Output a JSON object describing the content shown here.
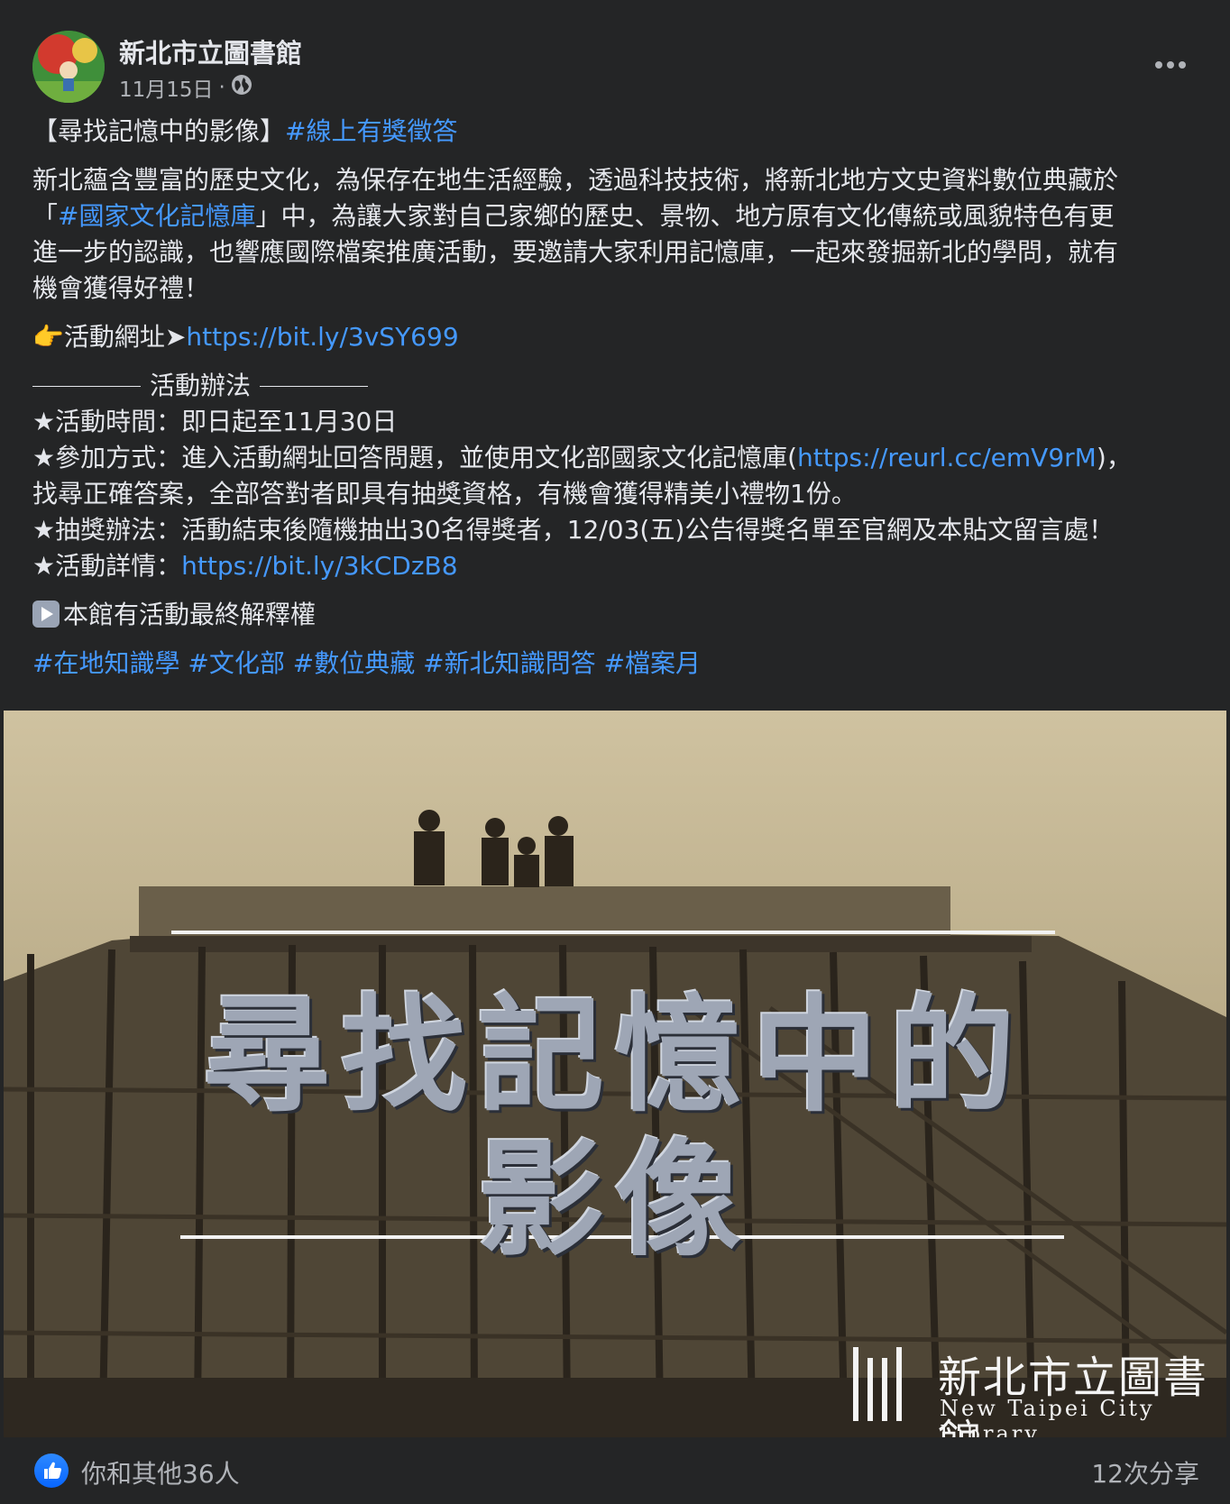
{
  "header": {
    "page_name": "新北市立圖書館",
    "date": "11月15日",
    "separator": "·",
    "privacy_icon": "globe-icon",
    "more_icon": "more-dots-icon"
  },
  "post": {
    "title_prefix": "【尋找記憶中的影像】",
    "title_hashtag": "#線上有獎徵答",
    "intro_1": "新北蘊含豐富的歷史文化，為保存在地生活經驗，透過科技技術，將新北地方文史資料數位典藏於",
    "intro_2_open": "「",
    "intro_2_link": "#國家文化記憶庫",
    "intro_2_rest": "」中，為讓大家對自己家鄉的歷史、景物、地方原有文化傳統或風貌特色有更",
    "intro_3": "進一步的認識，也響應國際檔案推廣活動，要邀請大家利用記憶庫，一起來發掘新北的學問，就有",
    "intro_4": "機會獲得好禮！",
    "event_url_label": "活動網址➤",
    "event_url": "https://bit.ly/3vSY699",
    "rules_heading": "活動辦法",
    "rule_time": "★活動時間：即日起至11月30日",
    "rule_join_prefix": "★參加方式：進入活動網址回答問題，並使用文化部國家文化記憶庫(",
    "rule_join_link": "https://reurl.cc/emV9rM",
    "rule_join_suffix": ")，",
    "rule_join_2": "找尋正確答案，全部答對者即具有抽獎資格，有機會獲得精美小禮物1份。",
    "rule_draw": "★抽獎辦法：活動結束後隨機抽出30名得獎者，12/03(五)公告得獎名單至官網及本貼文留言處！",
    "rule_detail_prefix": "★活動詳情：",
    "rule_detail_link": "https://bit.ly/3kCDzB8",
    "disclaimer": "本館有活動最終解釋權",
    "hashtags": [
      "#在地知識學",
      "#文化部",
      "#數位典藏",
      "#新北知識問答",
      "#檔案月"
    ]
  },
  "image": {
    "title_line1": "尋找記憶中的",
    "title_line2": "影像",
    "logo_name": "新北市立圖書館",
    "logo_sub": "New Taipei City Library"
  },
  "footer": {
    "reactions_text": "你和其他36人",
    "shares_text": "12次分享",
    "like_icon": "like-thumb-icon"
  },
  "colors": {
    "background": "#242526",
    "text": "#e4e6eb",
    "secondary_text": "#b0b3b8",
    "link": "#4599ff",
    "like_blue": "#0866ff"
  }
}
